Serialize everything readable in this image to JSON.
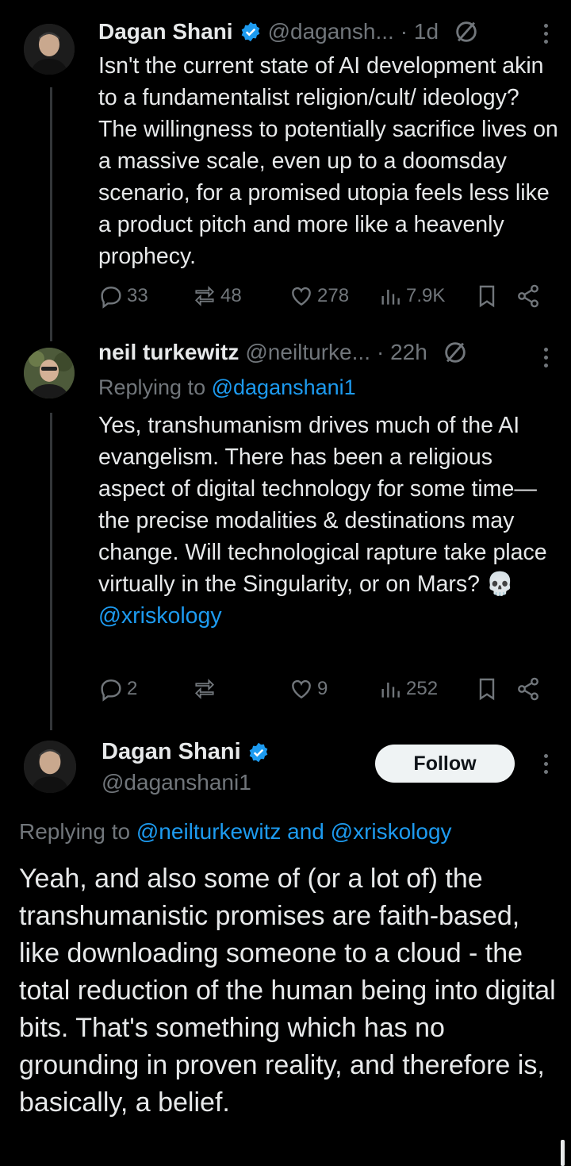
{
  "tweets": [
    {
      "name": "Dagan Shani",
      "handle": "@dagansh...",
      "time": "· 1d",
      "text": "Isn't the current state of AI development akin to a fundamentalist religion/cult/ ideology? The willingness to potentially sacrifice lives on a massive scale, even up to a doomsday scenario, for a promised utopia feels less like a product pitch and more like a heavenly prophecy.",
      "replies": "33",
      "reposts": "48",
      "likes": "278",
      "views": "7.9K"
    },
    {
      "name": "neil turkewitz",
      "handle": "@neilturke...",
      "time": "· 22h",
      "replying_prefix": "Replying to",
      "replying_to": "@daganshani1",
      "text": "Yes, transhumanism drives much of the AI evangelism. There has been a religious aspect of digital technology for some time—the precise modalities & destinations may change. Will technological rapture take place virtually in the Singularity, or on Mars? 💀",
      "mention": "@xriskology",
      "replies": "2",
      "reposts": "",
      "likes": "9",
      "views": "252"
    }
  ],
  "main_tweet": {
    "name": "Dagan Shani",
    "handle": "@daganshani1",
    "follow_label": "Follow",
    "replying_prefix": "Replying to",
    "replying_to_1": "@neilturkewitz",
    "replying_and": "and",
    "replying_to_2": "@xriskology",
    "text": "Yeah, and also some of (or a lot of) the transhumanistic promises are faith-based, like downloading someone to a cloud - the total reduction of the human being into digital bits. That's something which has no grounding in proven reality, and therefore is, basically, a belief."
  },
  "icons": [
    "verified-icon",
    "grok-icon",
    "more-icon",
    "reply-icon",
    "repost-icon",
    "like-icon",
    "views-icon",
    "bookmark-icon",
    "share-icon"
  ],
  "colors": {
    "background": "#000000",
    "text": "#e7e9ea",
    "muted": "#71767b",
    "link": "#1d9bf0",
    "verified": "#1d9bf0"
  }
}
